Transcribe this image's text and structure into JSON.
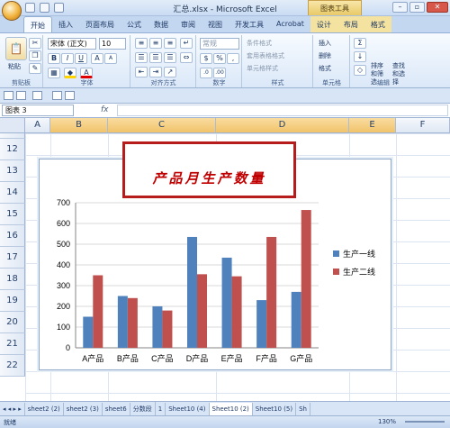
{
  "window": {
    "title": "汇总.xlsx - Microsoft Excel",
    "context_tab_title": "图表工具"
  },
  "tabs": [
    "开始",
    "插入",
    "页面布局",
    "公式",
    "数据",
    "审阅",
    "视图",
    "开发工具",
    "Acrobat",
    "设计",
    "布局",
    "格式"
  ],
  "ribbon": {
    "paste": "粘贴",
    "font_name": "宋体 (正文)",
    "font_size": "10",
    "groups": [
      "剪贴板",
      "字体",
      "对齐方式",
      "数字",
      "样式",
      "单元格",
      "编辑"
    ],
    "number_format": "常规",
    "styles": [
      "条件格式",
      "套用表格格式",
      "单元格样式"
    ],
    "cells": [
      "插入",
      "删除",
      "格式"
    ],
    "sort": "排序和筛选",
    "find": "查找和选择"
  },
  "formula": {
    "name_box": "图表 3",
    "fx": "fx"
  },
  "columns": [
    "A",
    "B",
    "C",
    "D",
    "E",
    "F"
  ],
  "rows": [
    "12",
    "13",
    "14",
    "15",
    "16",
    "17",
    "18",
    "19",
    "20",
    "21",
    "22"
  ],
  "title_box": "产品月生产数量",
  "chart_data": {
    "type": "bar",
    "categories": [
      "A产品",
      "B产品",
      "C产品",
      "D产品",
      "E产品",
      "F产品",
      "G产品"
    ],
    "series": [
      {
        "name": "生产一线",
        "values": [
          150,
          250,
          200,
          535,
          435,
          230,
          270
        ],
        "color": "#4f81bd"
      },
      {
        "name": "生产二线",
        "values": [
          350,
          240,
          180,
          355,
          345,
          535,
          665
        ],
        "color": "#c0504d"
      }
    ],
    "ylim": [
      0,
      700
    ],
    "yticks": [
      "0",
      "100",
      "200",
      "300",
      "400",
      "500",
      "600",
      "700"
    ],
    "legend": "right"
  },
  "sheet_tabs": [
    "sheet2 (2)",
    "sheet2 (3)",
    "sheet6",
    "分数段",
    "1",
    "Sheet10 (4)",
    "Sheet10 (2)",
    "Sheet10 (5)",
    "Sh"
  ],
  "status": {
    "ready": "就绪",
    "zoom": "130%"
  }
}
